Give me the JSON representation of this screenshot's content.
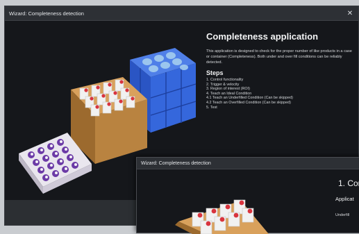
{
  "window_main": {
    "title": "Wizard: Completeness detection",
    "close_symbol": "✕"
  },
  "content": {
    "heading": "Completeness application",
    "description": "This application is designed to check for the proper number of like products in a case or container (Completeness). Both under and over fill conditions can be reliably detected.",
    "steps_heading": "Steps",
    "steps": [
      "1. Control functionality",
      "2. Trigger & velocity",
      "3. Region of interest (ROI)",
      "4. Teach an Ideal Condition",
      "4.1 Teach an Underfilled Condition (Can be skipped)",
      "4.2 Teach an Overfilled Condition (Can be skipped)",
      "5. Test"
    ]
  },
  "window_overlay": {
    "title": "Wizard: Completeness detection",
    "heading": "1. Con",
    "subheading": "Applicat",
    "text": "Underfill"
  },
  "colors": {
    "window_bg": "#15171b",
    "titlebar_bg": "#2d3035",
    "crate_blue": "#2f5fd6",
    "box_brown": "#b98340",
    "bottle_cap_red": "#d8343e",
    "tray_purple": "#6b3aa6"
  },
  "icons": [
    "close-icon"
  ]
}
